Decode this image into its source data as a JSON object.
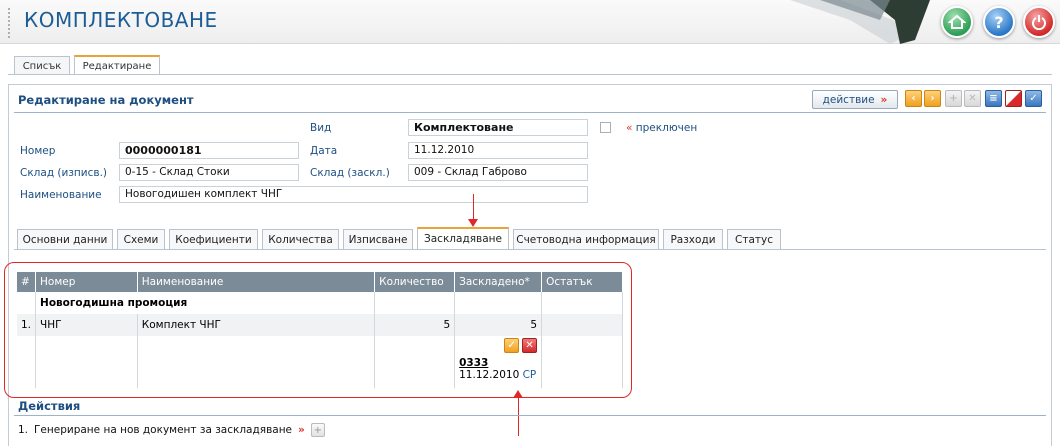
{
  "header": {
    "title": "КОМПЛЕКТОВАНЕ",
    "buttons": {
      "home": "home-icon",
      "help": "?",
      "power": "power-icon"
    }
  },
  "top_tabs": [
    "Списък",
    "Редактиране"
  ],
  "panel": {
    "title": "Редактиране на документ",
    "action_label": "действие",
    "action_arrow": "»"
  },
  "form": {
    "type_label": "Вид",
    "type_value": "Комплектоване",
    "number_label": "Номер",
    "number_value": "0000000181",
    "date_label": "Дата",
    "date_value": "11.12.2010",
    "out_wh_label": "Склад (изписв.)",
    "out_wh_value": "0-15 - Склад Стоки",
    "in_wh_label": "Склад (заскл.)",
    "in_wh_value": "009 - Склад Габрово",
    "name_label": "Наименование",
    "name_value": "Новогодишен комплект ЧНГ",
    "switched_prefix": "«",
    "switched_label": "преключен"
  },
  "inner_tabs": [
    "Основни данни",
    "Схеми",
    "Коефициенти",
    "Количества",
    "Изписване",
    "Заскладяване",
    "Счетоводна информация",
    "Разходи",
    "Статус"
  ],
  "grid": {
    "headers": [
      "#",
      "Номер",
      "Наименование",
      "Количество",
      "Заскладено*",
      "Остатък"
    ],
    "group": "Новогодишна промоция",
    "row": {
      "index": "1.",
      "number": "ЧНГ",
      "name": "Комплект ЧНГ",
      "qty": "5",
      "stored": "5",
      "rest": ""
    },
    "doc_number": "0333",
    "doc_date": "11.12.2010",
    "doc_link": "СР"
  },
  "actions": {
    "title": "Действия",
    "item_index": "1.",
    "item_label": "Генериране на нов документ за заскладяване",
    "item_arrow": "»"
  },
  "colors": {
    "accent": "#1d4f82",
    "highlight": "#e02828",
    "tab_active": "#e8a33a"
  }
}
